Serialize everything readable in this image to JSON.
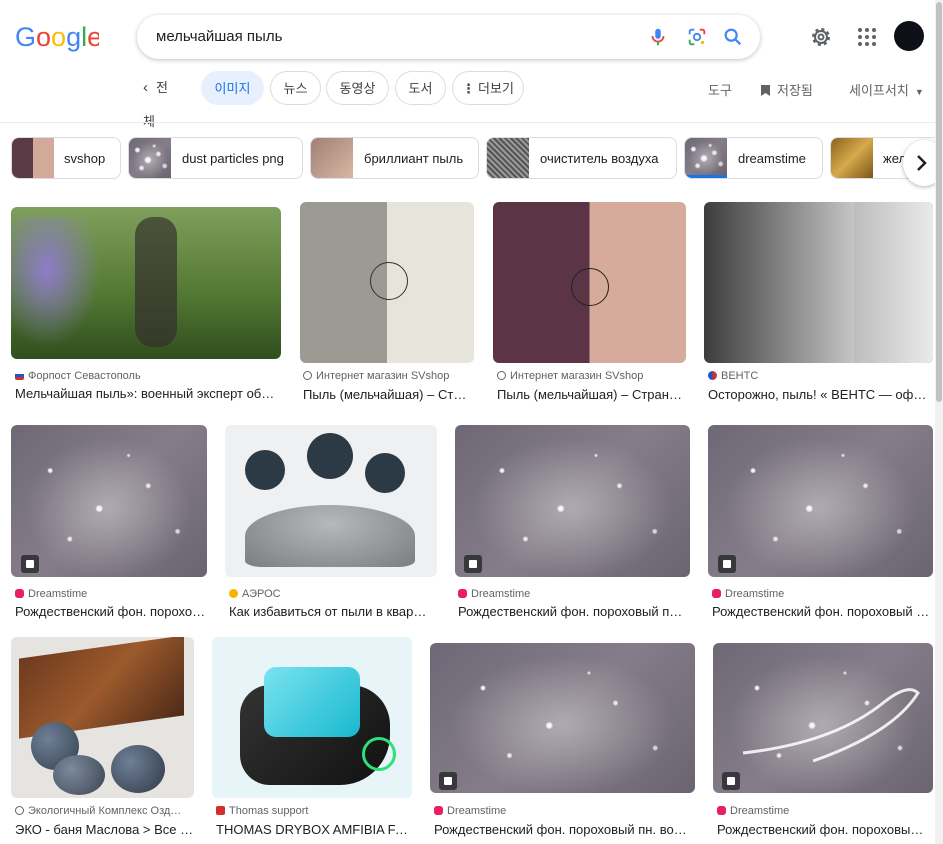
{
  "search": {
    "query": "мельчайшая пыль"
  },
  "tabs": {
    "back_label": "전체",
    "items": [
      "이미지",
      "뉴스",
      "동영상",
      "도서",
      "더보기"
    ],
    "tools": "도구",
    "saved": "저장됨",
    "safesearch": "세이프서치"
  },
  "chips": [
    "svshop",
    "dust particles png",
    "бриллиант пыль",
    "очиститель воздуха",
    "dreamstime",
    "жел"
  ],
  "results": [
    {
      "source": "Форпост Севастополь",
      "title": "Мельчайшая пыль»: военный эксперт об…"
    },
    {
      "source": "Интернет магазин SVshop",
      "title": "Пыль (мельчайшая) – Стр…"
    },
    {
      "source": "Интернет магазин SVshop",
      "title": "Пыль (мельчайшая) – Стран…"
    },
    {
      "source": "ВЕНТС",
      "title": "Осторожно, пыль! « ВЕНТС — офиц…"
    },
    {
      "source": "Dreamstime",
      "title": "Рождественский фон. порохо…"
    },
    {
      "source": "АЭРОС",
      "title": "Как избавиться от пыли в квар…"
    },
    {
      "source": "Dreamstime",
      "title": "Рождественский фон. пороховый п…"
    },
    {
      "source": "Dreamstime",
      "title": "Рождественский фон. пороховый …"
    },
    {
      "source": "Экологичный Комплекс Озд…",
      "title": "ЭКО - баня Маслова > Все …"
    },
    {
      "source": "Thomas support",
      "title": "THOMAS DRYBOX AMFIBIA FA…"
    },
    {
      "source": "Dreamstime",
      "title": "Рождественский фон. пороховый пн. во…"
    },
    {
      "source": "Dreamstime",
      "title": "Рождественский фон. пороховы…"
    }
  ]
}
